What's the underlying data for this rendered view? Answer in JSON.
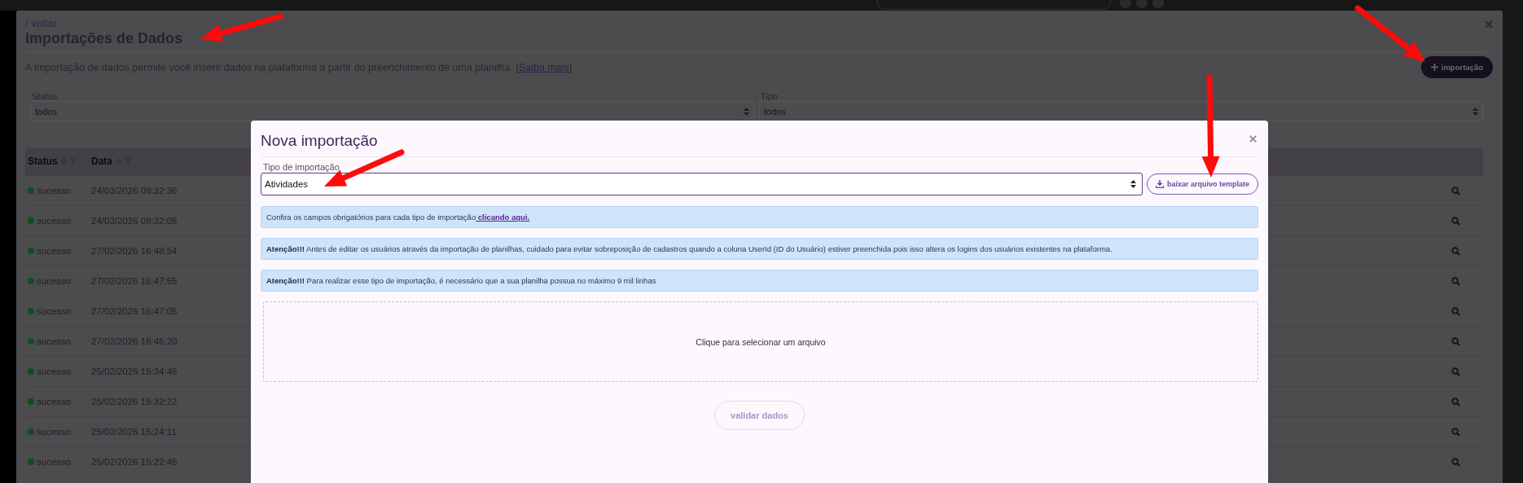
{
  "page": {
    "breadcrumb": "/ voltar",
    "title": "Importações de Dados",
    "description": "A importação de dados permite você inserir dados na plataforma a partir do preenchimento de uma planilha. [",
    "link": "Saiba mais",
    "description_end": "]",
    "new_button": "importação"
  },
  "filters": [
    {
      "label": "Status",
      "value": "todos"
    },
    {
      "label": "Tipo",
      "value": "todos"
    }
  ],
  "table": {
    "columns": [
      {
        "label": "Status"
      },
      {
        "label": "Data"
      }
    ],
    "rows": [
      {
        "status": "sucesso",
        "color": "#0e4f1c",
        "date": "24/03/2026 09:32:36"
      },
      {
        "status": "sucesso",
        "color": "#0e4f1c",
        "date": "24/03/2026 09:32:05"
      },
      {
        "status": "sucesso",
        "color": "#0e4f1c",
        "date": "27/02/2026 16:48:54"
      },
      {
        "status": "sucesso",
        "color": "#0e4f1c",
        "date": "27/02/2026 16:47:55"
      },
      {
        "status": "sucesso",
        "color": "#0e4f1c",
        "date": "27/02/2026 16:47:05"
      },
      {
        "status": "sucesso",
        "color": "#0e4f1c",
        "date": "27/02/2026 16:45:20"
      },
      {
        "status": "sucesso",
        "color": "#0e4f1c",
        "date": "25/02/2026 15:34:45"
      },
      {
        "status": "sucesso",
        "color": "#0e4f1c",
        "date": "25/02/2026 15:32:22"
      },
      {
        "status": "sucesso",
        "color": "#0e4f1c",
        "date": "25/02/2026 15:24:11"
      },
      {
        "status": "sucesso",
        "color": "#0e4f1c",
        "date": "25/02/2026 15:22:45"
      }
    ]
  },
  "modal": {
    "title": "Nova importação",
    "field_label": "Tipo de importação",
    "field_value": "Atividades",
    "template_button": "baixar arquivo template",
    "alerts": [
      {
        "kind": "link",
        "text": "Confira os campos obrigatórios para cada tipo de importação",
        "link": " clicando aqui."
      },
      {
        "kind": "warning",
        "text": "**Atenção!!!** Antes de editar os usuários através da importação de planilhas, cuidado para evitar sobreposição de cadastros quando a coluna UserId (ID do Usuário) estiver preenchida pois isso altera os logins dos usuários existentes na plataforma."
      },
      {
        "kind": "warning",
        "text": "**Atenção!!!** Para realizar esse tipo de importação, é necessário que a sua planilha possua no máximo 9 mil linhas"
      }
    ],
    "dropzone": "Clique para selecionar um arquivo",
    "validate_button": {
      "label": "validar dados",
      "disabled": true
    }
  }
}
